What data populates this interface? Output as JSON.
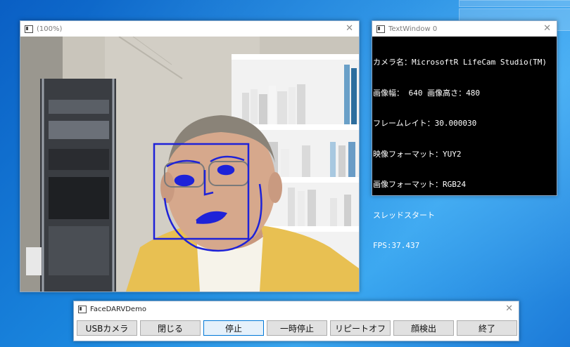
{
  "desktop": {
    "accent": "#1a86de"
  },
  "camera_window": {
    "title": "(100%)",
    "close_glyph": "✕"
  },
  "text_window": {
    "title": "TextWindow 0",
    "close_glyph": "✕",
    "lines": [
      "カメラ名：MicrosoftR LifeCam Studio(TM)",
      "画像幅： 640 画像高さ：480",
      "フレームレイト：30.000030",
      "映像フォーマット：YUY2",
      "画像フォーマット：RGB24",
      "スレッドスタート",
      "FPS:37.437"
    ]
  },
  "control_window": {
    "title": "FaceDARVDemo",
    "close_glyph": "✕",
    "buttons": [
      "USBカメラ",
      "閉じる",
      "停止",
      "一時停止",
      "リピートオフ",
      "顔検出",
      "終了"
    ]
  },
  "colors": {
    "detection": "#1e22d8",
    "console_bg": "#000000",
    "console_fg": "#ffffff"
  }
}
